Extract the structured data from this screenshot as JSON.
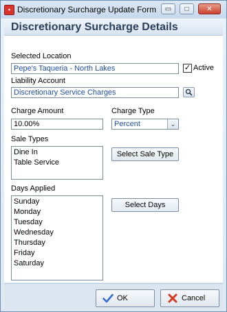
{
  "window": {
    "title": "Discretionary Surcharge Update Form",
    "minimize_glyph": "▭",
    "maximize_glyph": "□",
    "close_glyph": "✕"
  },
  "header": {
    "title": "Discretionary Surcharge Details"
  },
  "form": {
    "location_label": "Selected Location",
    "location_value": "Pepe's Taqueria - North Lakes",
    "active_label": "Active",
    "active_checked": true,
    "liability_label": "Liability Account",
    "liability_value": "Discretionary Service Charges",
    "lookup_icon": "magnifier-icon",
    "charge_amount_label": "Charge Amount",
    "charge_amount_value": "10.00%",
    "charge_type_label": "Charge Type",
    "charge_type_value": "Percent",
    "sale_types_label": "Sale Types",
    "sale_types": [
      "Dine In",
      "Table Service"
    ],
    "select_sale_type_label": "Select Sale Type",
    "days_label": "Days Applied",
    "days": [
      "Sunday",
      "Monday",
      "Tuesday",
      "Wednesday",
      "Thursday",
      "Friday",
      "Saturday"
    ],
    "select_days_label": "Select Days"
  },
  "footer": {
    "ok_label": "OK",
    "cancel_label": "Cancel"
  },
  "colors": {
    "header_text": "#2b3f59",
    "value_text": "#1f4fa8",
    "ok_check": "#2f6fd0",
    "cancel_x": "#d23a22"
  }
}
